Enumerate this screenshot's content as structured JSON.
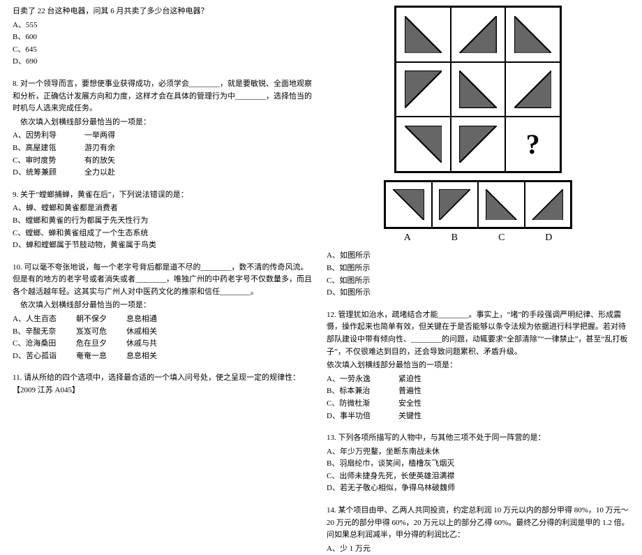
{
  "left": {
    "q7": {
      "text": "日卖了 22 台这种电器，问其 6 月共卖了多少台这种电器？",
      "a": "A、555",
      "b": "B、600",
      "c": "C、645",
      "d": "D、690"
    },
    "q8": {
      "text": "8. 对一个领导而言，要想使事业获得成功，必须学会________，就是要敏锐、全面地观察和分析，正确估计发展方向和力度，这样才会在具体的管理行为中________，选择恰当的时机与人选来完成任务。",
      "prompt": "　依次填入划横线部分最恰当的一项是：",
      "a1": "A、因势利导",
      "a2": "一举两得",
      "b1": "B、高屋建瓴",
      "b2": "游刃有余",
      "c1": "C、审时度势",
      "c2": "有的放矢",
      "d1": "D、统筹兼顾",
      "d2": "全力以赴"
    },
    "q9": {
      "text": "9. 关于“螳螂捕蝉，黄雀在后”，下列说法错误的是：",
      "a": "A、蝉、螳螂和黄雀都是消费者",
      "b": "B、螳螂和黄雀的行为都属于先天性行为",
      "c": "C、螳螂、蝉和黄雀组成了一个生态系统",
      "d": "D、蝉和螳螂属于节肢动物，黄雀属于鸟类"
    },
    "q10": {
      "text": "10. 可以毫不夸张地说，每一个老字号背后都是道不尽的________，数不清的传奇风流。但是有的地方的老字号或者消失或者________，唯独广州的中药老字号不仅数量多，而且各个越活越年轻。这其实与广州人对中医药文化的推崇和信任________。",
      "prompt": "　依次填入划横线部分最恰当的一项是：",
      "a1": "A、人生百态",
      "a2": "朝不保夕",
      "a3": "息息相通",
      "b1": "B、辛酸无奈",
      "b2": "岌岌可危",
      "b3": "休戚相关",
      "c1": "C、沧海桑田",
      "c2": "危在旦夕",
      "c3": "休戚与共",
      "d1": "D、苦心孤诣",
      "d2": "奄奄一息",
      "d3": "息息相关"
    },
    "q11": {
      "text": "11. 请从所给的四个选项中，选择最合适的一个填入问号处，使之呈现一定的规律性：【2009 江苏 A045】"
    }
  },
  "right": {
    "ansA": "A",
    "ansB": "B",
    "ansC": "C",
    "ansD": "D",
    "q11opts": {
      "a": "A、如图所示",
      "b": "B、如图所示",
      "c": "C、如图所示",
      "d": "D、如图所示"
    },
    "q12": {
      "text": "12. 管理犹如治水，疏堵结合才能________。事实上，“堵”的手段强调严明纪律、形成震慑，操作起来也简单有效，但关键在于是否能够以条令法规为依据进行科学把握。若对待部队建设中带有倾向性、________的问题，动辄要求“全部清除”“一律禁止”，甚至“乱打板子”，不仅很难达到目的，还会导致问题累积、矛盾升级。",
      "prompt": "依次填入划横线部分最恰当的一项是：",
      "a1": "A、一劳永逸",
      "a2": "紧迫性",
      "b1": "B、标本兼治",
      "b2": "普遍性",
      "c1": "C、防微杜渐",
      "c2": "安全性",
      "d1": "D、事半功倍",
      "d2": "关键性"
    },
    "q13": {
      "text": "13. 下列各项所描写的人物中，与其他三项不处于同一阵营的是：",
      "a": "A、年少万兜鍪，坐断东南战未休",
      "b": "B、羽扇纶巾，谈笑间，樯橹灰飞烟灭",
      "c": "C、出师未捷身先死，长使英雄泪满襟",
      "d": "D、若无子敬心相似，争得乌林破魏师"
    },
    "q14": {
      "text": "14. 某个项目由甲、乙两人共同投资，约定总利润 10 万元以内的部分甲得 80%，10 万元～20 万元的部分甲得 60%，20 万元以上的部分乙得 60%。最终乙分得的利润是甲的 1.2 倍。问如果总利润减半，甲分得的利润比乙：",
      "a": "A、少 1 万元"
    }
  }
}
